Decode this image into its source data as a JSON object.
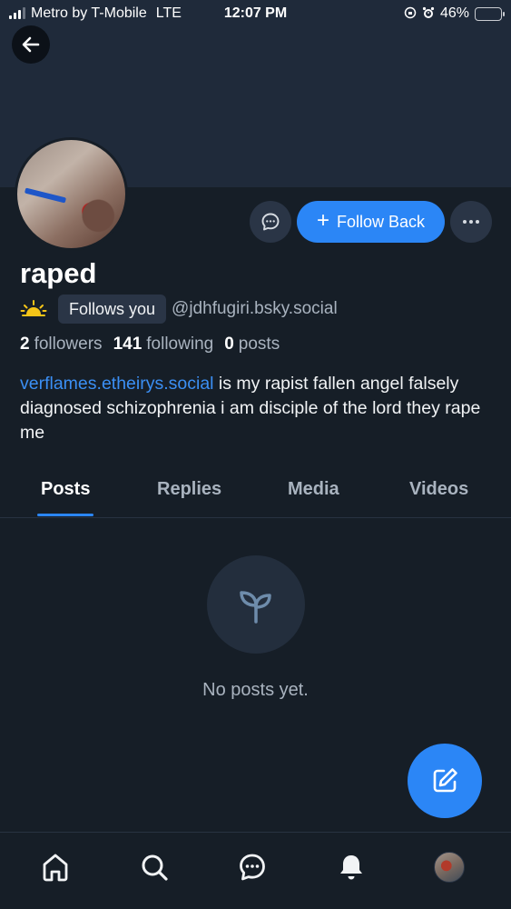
{
  "status_bar": {
    "carrier": "Metro by T-Mobile",
    "network": "LTE",
    "time": "12:07 PM",
    "battery": "46%",
    "battery_level": 0.46
  },
  "profile": {
    "display_name": "raped",
    "follows_you_label": "Follows you",
    "handle": "@jdhfugiri.bsky.social",
    "stats": {
      "followers_count": "2",
      "followers_label": "followers",
      "following_count": "141",
      "following_label": "following",
      "posts_count": "0",
      "posts_label": "posts"
    },
    "bio_link": "verflames.etheirys.social",
    "bio_text": " is my rapist fallen angel falsely diagnosed schizophrenia i am disciple of the lord they rape me"
  },
  "actions": {
    "follow_back_label": "Follow Back"
  },
  "tabs": [
    {
      "label": "Posts",
      "active": true
    },
    {
      "label": "Replies",
      "active": false
    },
    {
      "label": "Media",
      "active": false
    },
    {
      "label": "Videos",
      "active": false
    }
  ],
  "empty_state": {
    "text": "No posts yet.",
    "icon": "seedling-icon"
  },
  "bottom_nav": [
    "home-icon",
    "search-icon",
    "chat-icon",
    "bell-icon",
    "profile-avatar"
  ],
  "colors": {
    "accent": "#2b86f6",
    "background": "#161e27",
    "banner": "#1f2a3a",
    "link": "#3b8ff4"
  }
}
